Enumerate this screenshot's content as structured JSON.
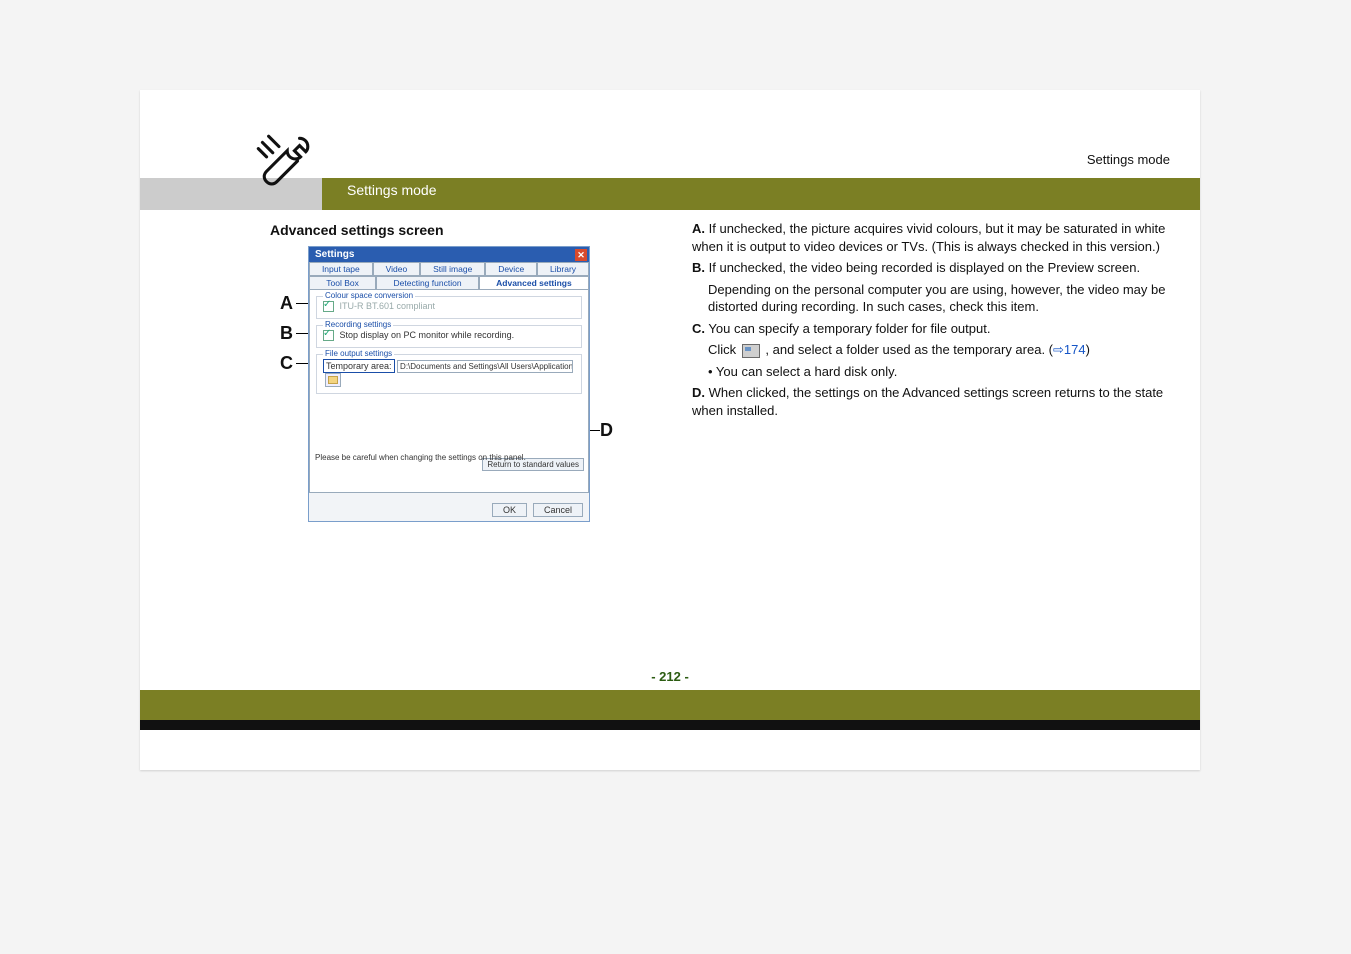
{
  "header": {
    "right_label": "Settings mode",
    "band_label": "Settings mode"
  },
  "left": {
    "section_title": "Advanced settings screen"
  },
  "callouts": {
    "a": "A",
    "b": "B",
    "c": "C",
    "d": "D"
  },
  "dialog": {
    "title": "Settings",
    "close_glyph": "✕",
    "tabs": {
      "input_tape": "Input tape",
      "video": "Video",
      "still_image": "Still image",
      "device": "Device",
      "library": "Library",
      "tool_box": "Tool Box",
      "detecting_function": "Detecting function",
      "advanced": "Advanced settings"
    },
    "group_colour": {
      "legend": "Colour space conversion",
      "opt": "ITU-R BT.601 compliant"
    },
    "group_recording": {
      "legend": "Recording settings",
      "opt": "Stop display on PC monitor while recording."
    },
    "group_file": {
      "legend": "File output settings",
      "label": "Temporary area:",
      "path": "D:\\Documents and Settings\\All Users\\Application Data\\Pan"
    },
    "return_btn": "Return to standard values",
    "note": "Please be careful when changing the settings on this panel.",
    "ok": "OK",
    "cancel": "Cancel"
  },
  "right": {
    "a_label": "A.",
    "a_text": "If unchecked, the picture acquires vivid colours, but it may be saturated in white when it is output to video devices or TVs. (This is always checked in this version.)",
    "b_label": "B.",
    "b_text1": "If unchecked, the video being recorded is displayed on the Preview screen.",
    "b_text2": "Depending on the personal computer you are using, however, the video may be distorted during recording. In such cases, check this item.",
    "c_label": "C.",
    "c_text1": "You can specify a temporary folder for file output.",
    "c_click": "Click ",
    "c_text2": ", and select a folder used as the temporary area. (",
    "c_link": "⇨174",
    "c_text3": ")",
    "c_bullet": "• You can select a hard disk only.",
    "d_label": "D.",
    "d_text": "When clicked, the settings on the Advanced settings screen returns to the state when installed."
  },
  "footer": {
    "page": "- 212 -"
  }
}
